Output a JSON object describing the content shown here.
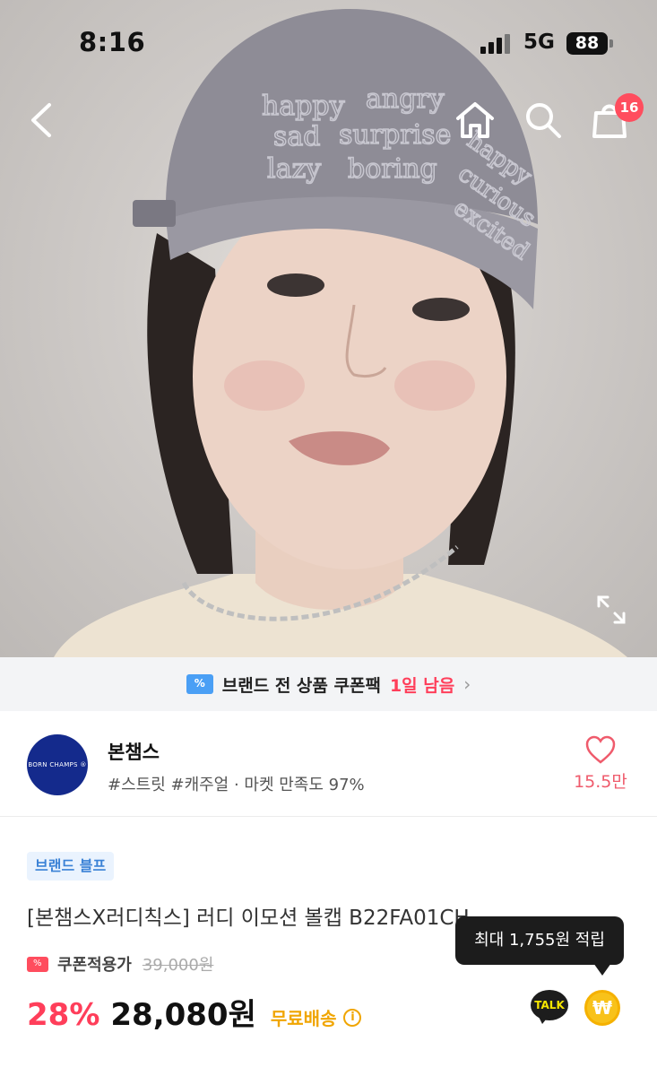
{
  "status_bar": {
    "time": "8:16",
    "network": "5G",
    "battery": "88"
  },
  "hero": {
    "cap_text": [
      "happy",
      "angry",
      "sad",
      "surprise",
      "lazy",
      "boring",
      "happy",
      "curious",
      "excited"
    ]
  },
  "nav": {
    "back_icon": "chevron-left-icon",
    "home_icon": "home-icon",
    "search_icon": "search-icon",
    "cart_icon": "shopping-bag-icon",
    "cart_count": "16"
  },
  "coupon_banner": {
    "text": "브랜드 전 상품 쿠폰팩",
    "remaining": "1일 남음",
    "arrow": "›"
  },
  "store": {
    "logo_text": "BORN CHAMPS ®",
    "name": "본챔스",
    "tags": "#스트릿 #캐주얼 · 마켓 만족도 97%",
    "like_count": "15.5만"
  },
  "product": {
    "badge": "브랜드 블프",
    "title": "[본챔스X러디칙스] 러디 이모션 볼캡 B22FA01CH",
    "coupon_label": "쿠폰적용가",
    "original_price": "39,000원",
    "discount": "28%",
    "final_price": "28,080원",
    "shipping": "무료배송",
    "info_icon": "i",
    "tooltip": "최대 1,755원 적립",
    "talk_label": "TALK",
    "reward_symbol": "₩"
  },
  "colors": {
    "accent_red": "#ff3e5a",
    "shipping_yellow": "#f0a500",
    "badge_blue": "#3b82d6",
    "store_logo_navy": "#142a8c"
  }
}
